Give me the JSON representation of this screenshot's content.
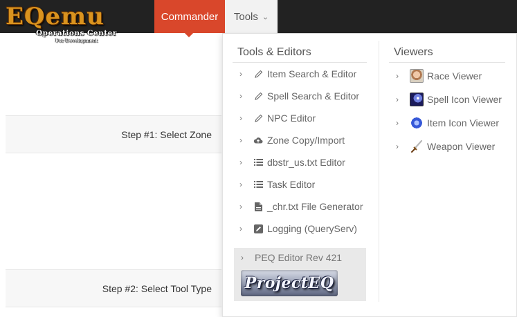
{
  "brand": {
    "logo_main": "EQemu",
    "logo_sub": "Operations Center",
    "logo_sub2": "For Development"
  },
  "nav": {
    "commander_label": "Commander",
    "tools_label": "Tools",
    "accent_color": "#d9472b"
  },
  "page": {
    "step1_label": "Step #1: Select Zone",
    "step2_label": "Step #2: Select Tool Type"
  },
  "dropdown": {
    "tools_editors": {
      "title": "Tools & Editors",
      "items": [
        {
          "label": "Item Search & Editor",
          "icon": "pencil-icon"
        },
        {
          "label": "Spell Search & Editor",
          "icon": "pencil-icon"
        },
        {
          "label": "NPC Editor",
          "icon": "pencil-icon"
        },
        {
          "label": "Zone Copy/Import",
          "icon": "cloud-upload-icon"
        },
        {
          "label": "dbstr_us.txt Editor",
          "icon": "list-icon"
        },
        {
          "label": "Task Editor",
          "icon": "list-icon"
        },
        {
          "label": "_chr.txt File Generator",
          "icon": "file-icon"
        },
        {
          "label": "Logging (QueryServ)",
          "icon": "edit-square-icon"
        }
      ],
      "footer_label": "PEQ Editor Rev 421",
      "footer_logo_text": "ProjectEQ"
    },
    "viewers": {
      "title": "Viewers",
      "items": [
        {
          "label": "Race Viewer",
          "icon": "race-portrait-icon"
        },
        {
          "label": "Spell Icon Viewer",
          "icon": "spell-icon"
        },
        {
          "label": "Item Icon Viewer",
          "icon": "item-icon"
        },
        {
          "label": "Weapon Viewer",
          "icon": "sword-icon"
        }
      ]
    }
  }
}
